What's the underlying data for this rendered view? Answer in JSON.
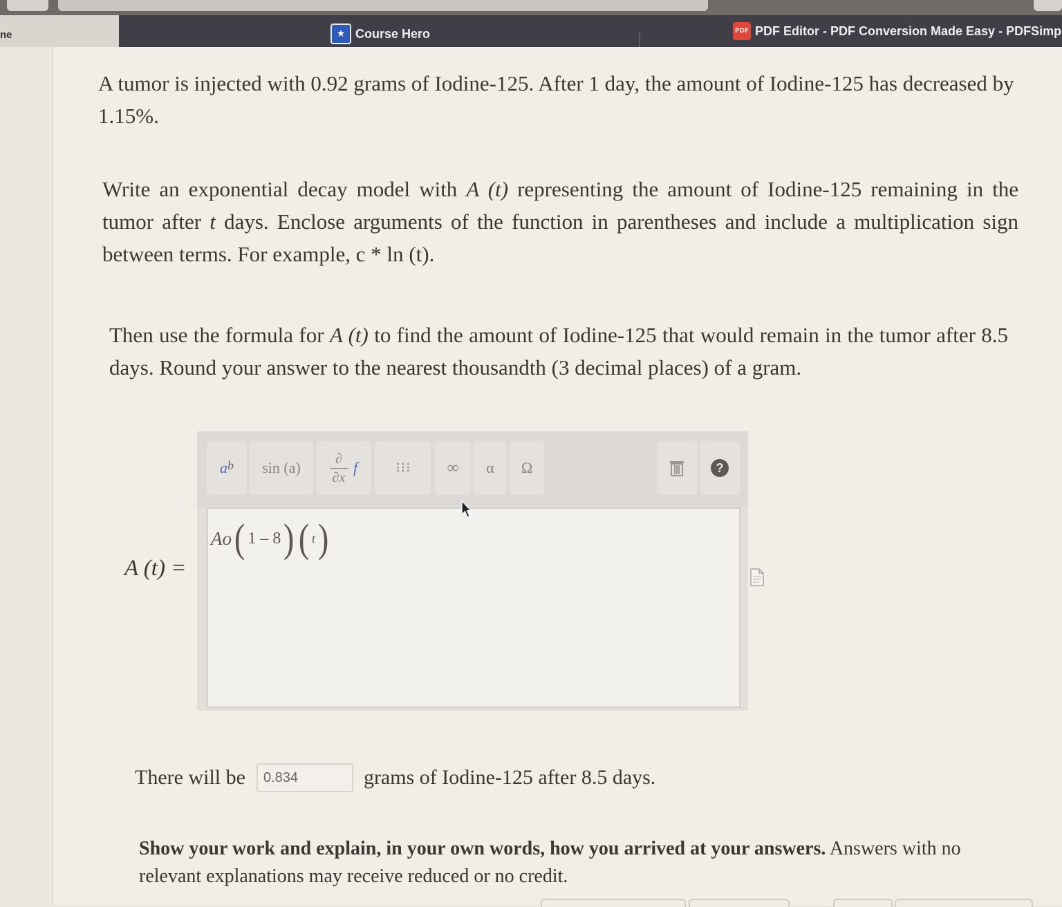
{
  "bookmarks": {
    "left_stub": "ne",
    "items": [
      {
        "label": "Course Hero",
        "icon": "course-hero-star-icon"
      },
      {
        "label": "PDF Editor - PDF Conversion Made Easy - PDFSimpl",
        "icon": "pdf-icon",
        "icon_text": "PDF"
      }
    ]
  },
  "question": {
    "intro": "A tumor is injected with 0.92 grams of Iodine-125. After 1 day, the amount of Iodine-125 has decreased by 1.15%.",
    "part1_a": "Write an exponential decay model with ",
    "part1_at": "A (t)",
    "part1_b": " representing the amount of Iodine-125 remaining in the tumor after ",
    "part1_t": "t",
    "part1_c": " days. Enclose arguments of the function in parentheses and include a multiplication sign between terms. For example, ",
    "part1_example": "c * ln (t)",
    "part1_d": ".",
    "part2_a": "Then use the formula for ",
    "part2_at": "A (t)",
    "part2_b": " to find the amount of Iodine-125 that would remain in the tumor after 8.5 days. Round your answer to the nearest thousandth (3 decimal places) of a gram."
  },
  "toolbar": {
    "power_a": "a",
    "power_b": "b",
    "sin": "sin (a)",
    "deriv_top": "∂",
    "deriv_bottom": "∂x",
    "deriv_f": "f",
    "matrix": "⋮⋮⋮",
    "infinity": "∞",
    "alpha": "α",
    "omega": "Ω",
    "help": "?"
  },
  "expression": {
    "lhs": "A (t) =",
    "ao": "Ao",
    "inner1": "1 – 8",
    "inner2": "t"
  },
  "answer": {
    "before": "There will be",
    "value": "0.834",
    "after": "grams of Iodine-125 after 8.5 days."
  },
  "instructions": {
    "bold": "Show your work and explain, in your own words, how you arrived at your answers.",
    "rest": " Answers with no relevant explanations may receive reduced or no credit."
  }
}
